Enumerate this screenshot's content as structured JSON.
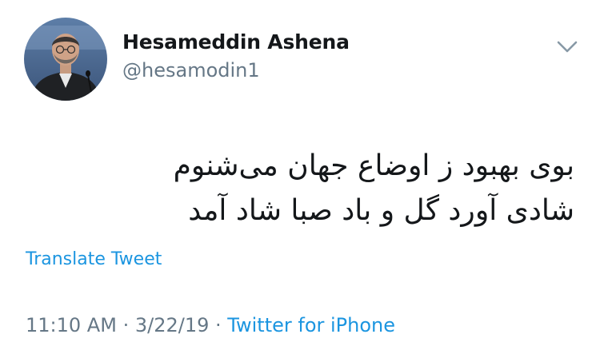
{
  "tweet": {
    "author": {
      "display_name": "Hesameddin Ashena",
      "handle": "@hesamodin1"
    },
    "text_lines": [
      "بوی بهبود ز اوضاع جهان می‌شنوم",
      "شادی آورد گل و باد صبا شاد آمد"
    ],
    "translate_label": "Translate Tweet",
    "meta": {
      "time": "11:10 AM",
      "separator": "·",
      "date": "3/22/19",
      "source": "Twitter for iPhone"
    }
  },
  "icons": {
    "caret": "chevron-down-icon",
    "avatar": "profile-photo"
  },
  "colors": {
    "name": "#14171a",
    "secondary": "#657786",
    "link": "#1b95e0",
    "background": "#ffffff"
  }
}
